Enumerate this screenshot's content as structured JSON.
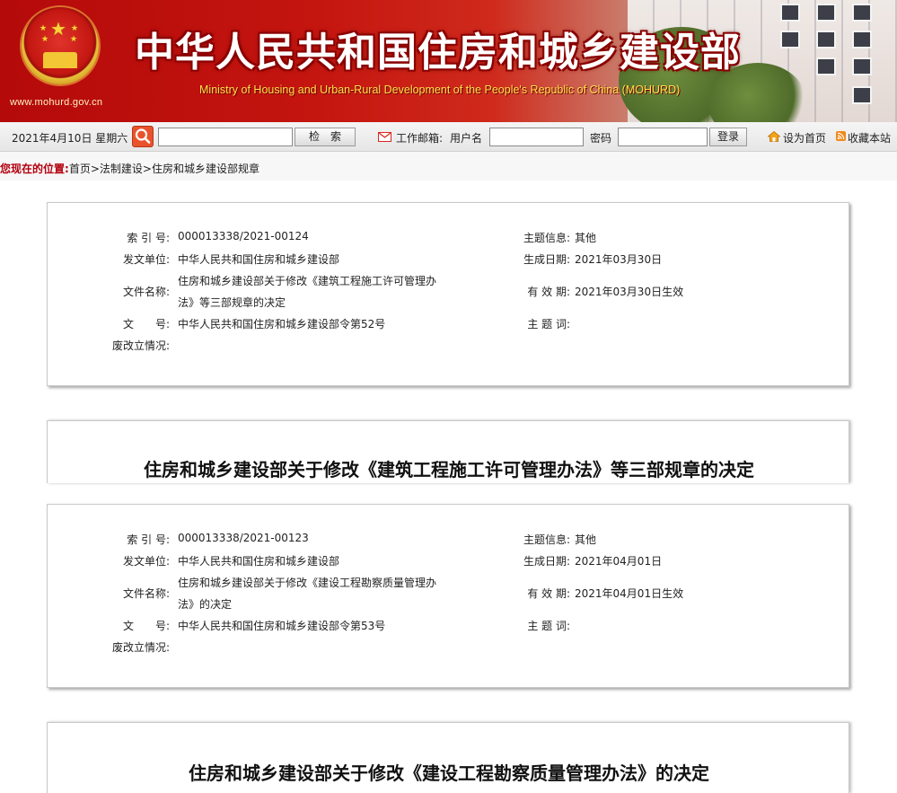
{
  "header": {
    "site_url": "www.mohurd.gov.cn",
    "title_cn": "中华人民共和国住房和城乡建设部",
    "title_en": "Ministry of Housing and Urban-Rural Development of the People's Republic of China (MOHURD)"
  },
  "toolbar": {
    "date": "2021年4月10日 星期六",
    "search_value": "",
    "search_button": "检　索",
    "mail_label": "工作邮箱:",
    "username_label": "用户名",
    "username_value": "",
    "password_label": "密码",
    "password_value": "",
    "login_button": "登录",
    "set_home": "设为首页",
    "bookmark": "收藏本站"
  },
  "breadcrumb": {
    "label": "您现在的位置:",
    "items": [
      "首页",
      "法制建设",
      "住房和城乡建设部规章"
    ],
    "separator": ">"
  },
  "documents": [
    {
      "index_no_label": "索 引 号:",
      "index_no": "000013338/2021-00124",
      "topic_label": "主题信息:",
      "topic": "其他",
      "issuer_label": "发文单位:",
      "issuer": "中华人民共和国住房和城乡建设部",
      "date_label": "生成日期:",
      "date": "2021年03月30日",
      "filename_label": "文件名称:",
      "filename_line1": "住房和城乡建设部关于修改《建筑工程施工许可管理办",
      "filename_line2": "法》等三部规章的决定",
      "validity_label": "有 效 期:",
      "validity": "2021年03月30日生效",
      "doc_no_label": "文　　号:",
      "doc_no": "中华人民共和国住房和城乡建设部令第52号",
      "keywords_label": "主 题 词:",
      "keywords": "",
      "status_label": "废改立情况:",
      "status": "",
      "heading": "住房和城乡建设部关于修改《建筑工程施工许可管理办法》等三部规章的决定"
    },
    {
      "index_no_label": "索 引 号:",
      "index_no": "000013338/2021-00123",
      "topic_label": "主题信息:",
      "topic": "其他",
      "issuer_label": "发文单位:",
      "issuer": "中华人民共和国住房和城乡建设部",
      "date_label": "生成日期:",
      "date": "2021年04月01日",
      "filename_label": "文件名称:",
      "filename_line1": "住房和城乡建设部关于修改《建设工程勘察质量管理办",
      "filename_line2": "法》的决定",
      "validity_label": "有 效 期:",
      "validity": "2021年04月01日生效",
      "doc_no_label": "文　　号:",
      "doc_no": "中华人民共和国住房和城乡建设部令第53号",
      "keywords_label": "主 题 词:",
      "keywords": "",
      "status_label": "废改立情况:",
      "status": "",
      "heading": "住房和城乡建设部关于修改《建设工程勘察质量管理办法》的决定"
    }
  ],
  "icons": {
    "emblem": "national-emblem-icon",
    "search": "magnifier-icon",
    "mail": "envelope-icon",
    "home": "house-icon",
    "bookmark": "rss-bookmark-icon"
  },
  "colors": {
    "banner_red": "#c4150f",
    "breadcrumb_label": "#b3000e",
    "title_yellow": "#ffe04a"
  }
}
